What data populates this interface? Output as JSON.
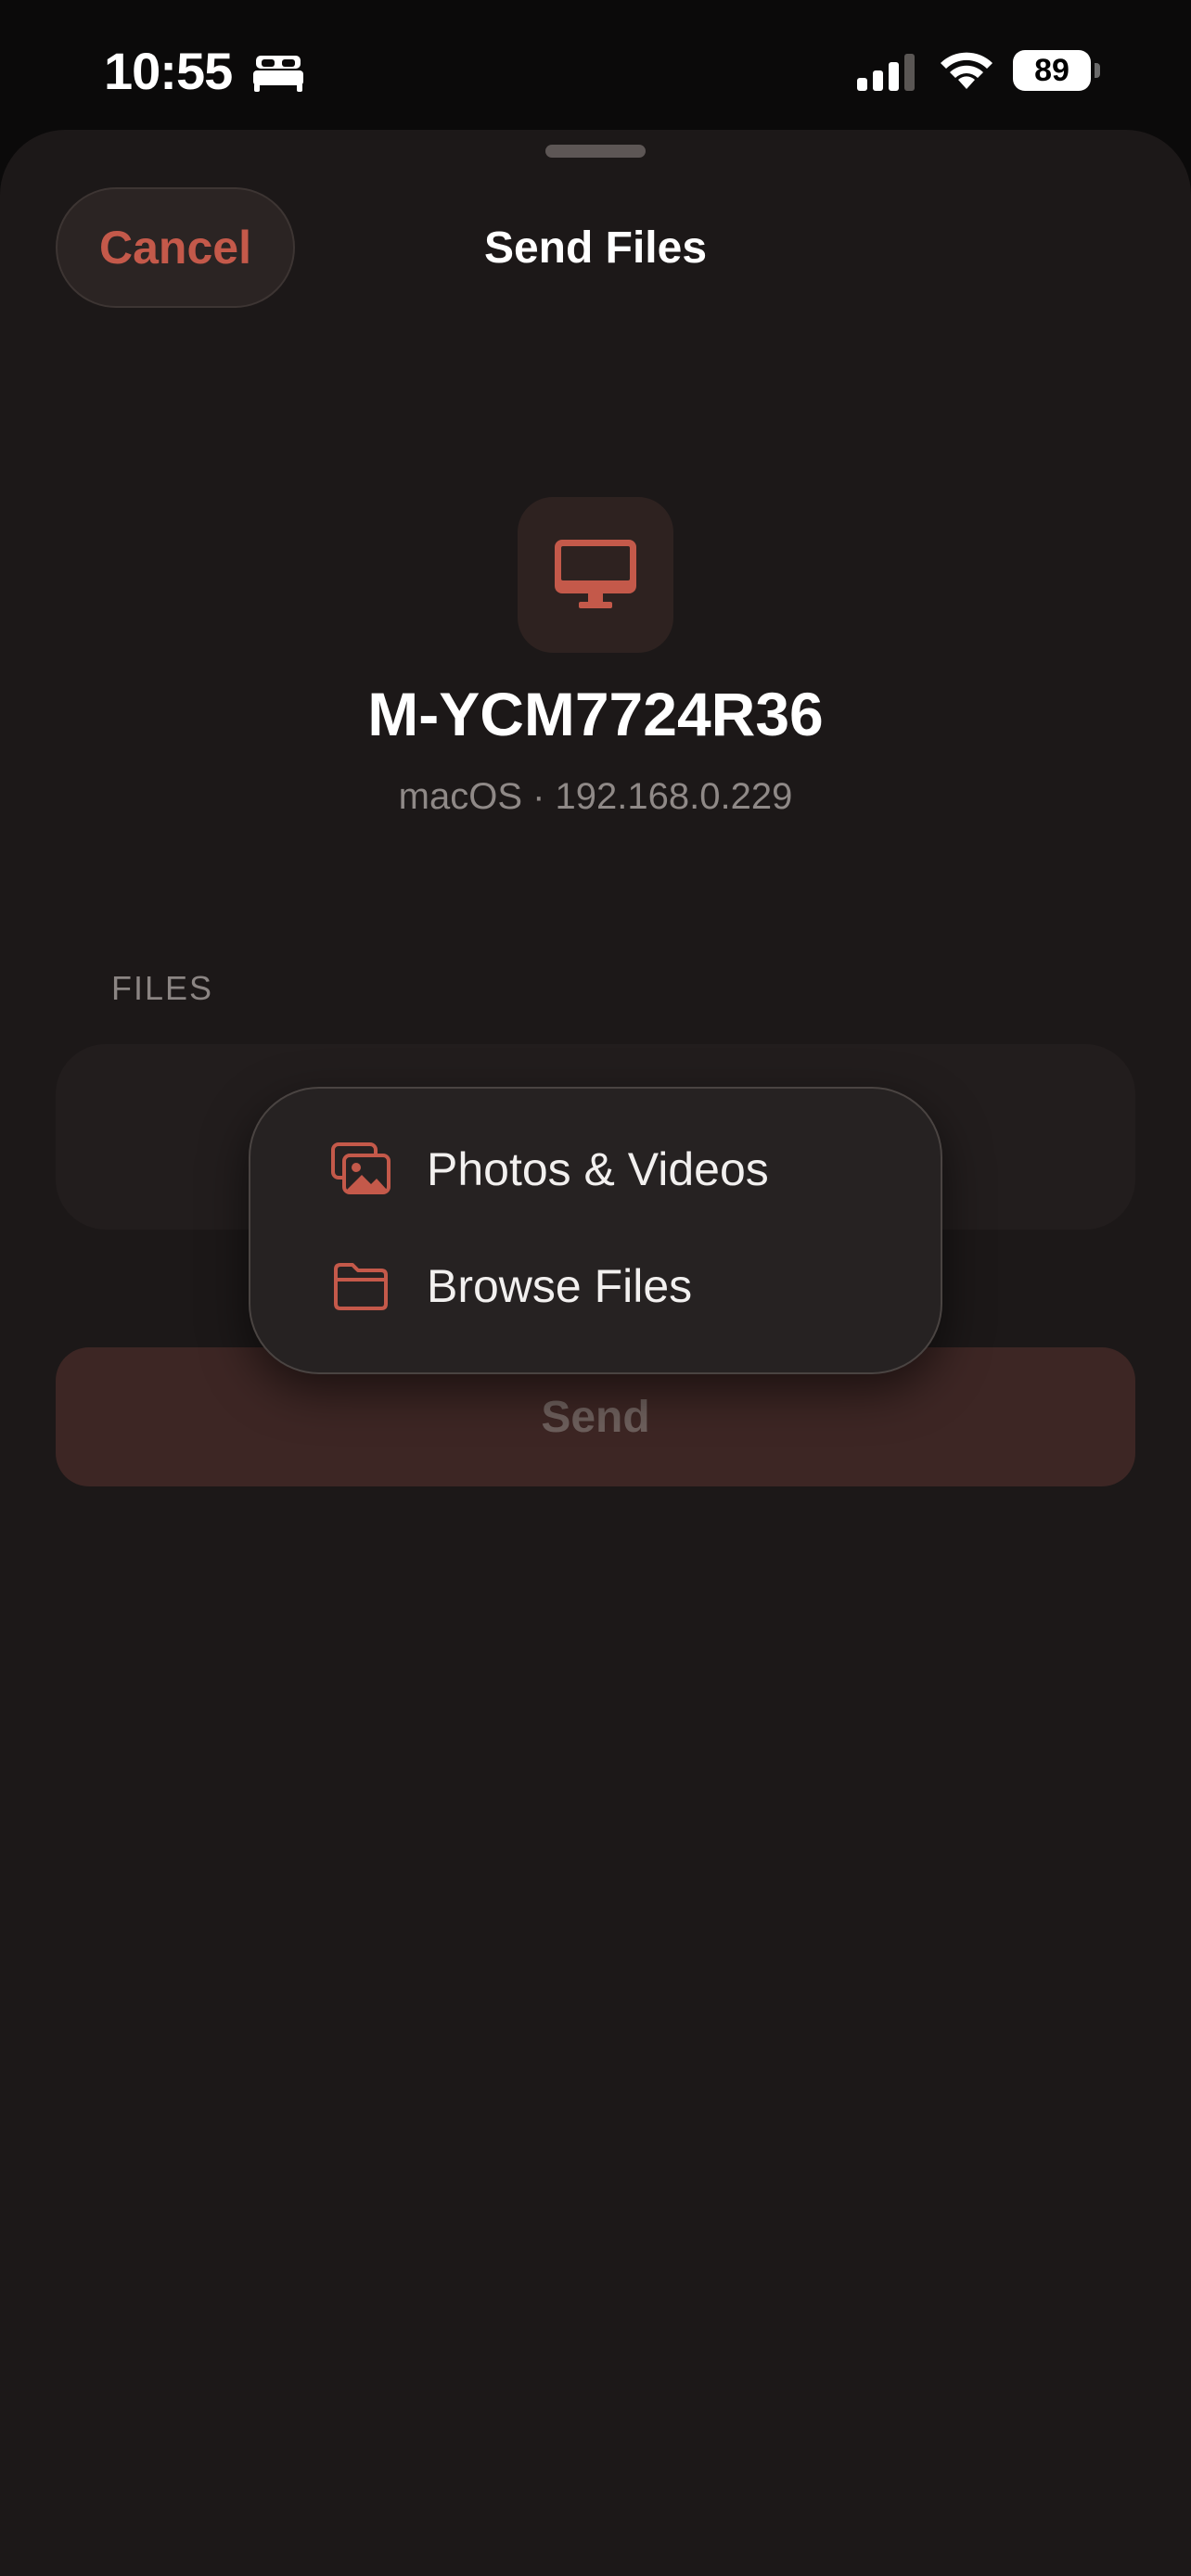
{
  "status_bar": {
    "time": "10:55",
    "battery": "89",
    "icons": [
      "sleep-bed-icon",
      "cellular-signal-icon",
      "wifi-icon",
      "battery-icon"
    ]
  },
  "sheet": {
    "title": "Send Files",
    "cancel_label": "Cancel"
  },
  "device": {
    "icon": "desktop-monitor-icon",
    "name": "M-YCM7724R36",
    "subtitle": "macOS · 192.168.0.229"
  },
  "files": {
    "section_label": "FILES"
  },
  "menu": {
    "items": [
      {
        "label": "Photos & Videos",
        "icon": "photo-library-icon"
      },
      {
        "label": "Browse Files",
        "icon": "folder-icon"
      }
    ]
  },
  "send_label": "Send",
  "colors": {
    "accent": "#c4594a",
    "sheet_background": "#1c1818",
    "send_disabled": "#3d2624"
  }
}
